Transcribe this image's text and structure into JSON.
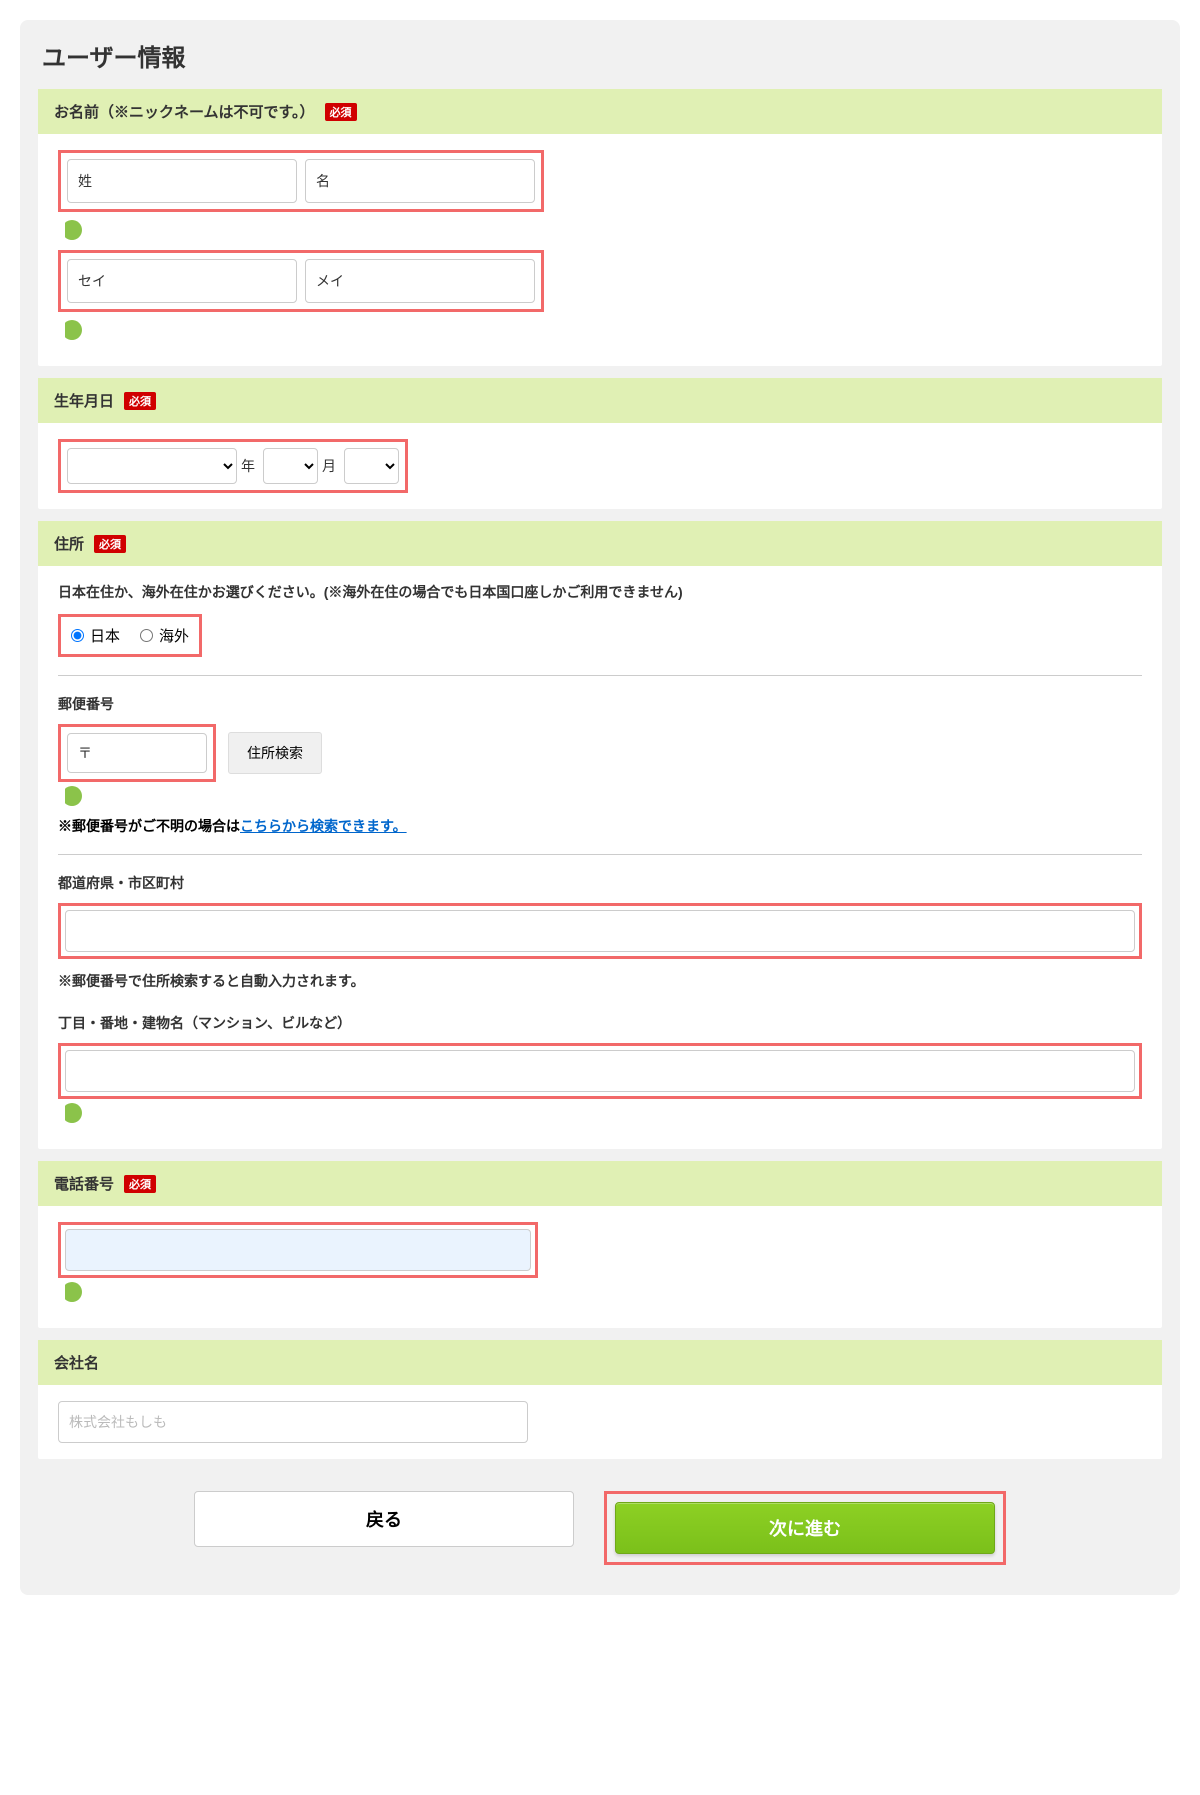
{
  "page": {
    "title": "ユーザー情報"
  },
  "badges": {
    "required": "必須"
  },
  "name": {
    "header": "お名前（※ニックネームは不可です。）",
    "sei_label": "姓",
    "mei_label": "名",
    "sei_kana_label": "セイ",
    "mei_kana_label": "メイ"
  },
  "dob": {
    "header": "生年月日",
    "year_suffix": "年",
    "month_suffix": "月"
  },
  "address": {
    "header": "住所",
    "residence_note": "日本在住か、海外在住かお選びください。(※海外在住の場合でも日本国口座しかご利用できません)",
    "opt_japan": "日本",
    "opt_overseas": "海外",
    "postal_label": "郵便番号",
    "postal_prefix": "〒",
    "search_btn": "住所検索",
    "postal_help_prefix": "※郵便番号がご不明の場合は",
    "postal_help_link": "こちらから検索できます。",
    "prefcity_label": "都道府県・市区町村",
    "prefcity_note": "※郵便番号で住所検索すると自動入力されます。",
    "detail_label": "丁目・番地・建物名（マンション、ビルなど）"
  },
  "tel": {
    "header": "電話番号"
  },
  "company": {
    "header": "会社名",
    "placeholder": "株式会社もしも"
  },
  "buttons": {
    "back": "戻る",
    "next": "次に進む"
  }
}
